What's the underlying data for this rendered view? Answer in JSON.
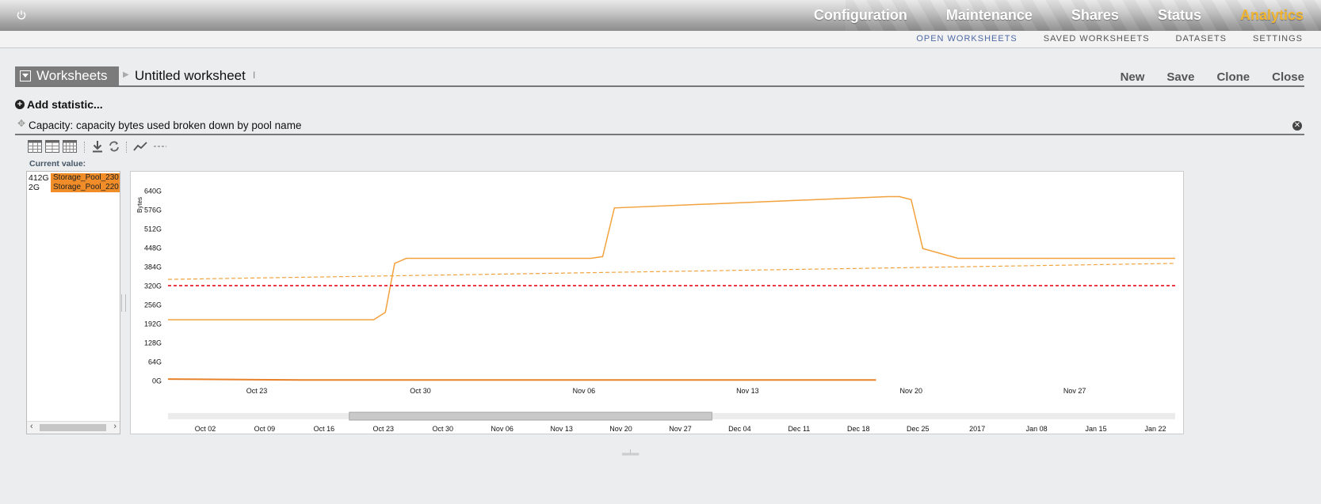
{
  "nav": {
    "items": [
      "Configuration",
      "Maintenance",
      "Shares",
      "Status",
      "Analytics"
    ],
    "active": "Analytics"
  },
  "subnav": {
    "items": [
      "OPEN WORKSHEETS",
      "SAVED WORKSHEETS",
      "DATASETS",
      "SETTINGS"
    ],
    "active": "OPEN WORKSHEETS"
  },
  "worksheet": {
    "tab_label": "Worksheets",
    "title": "Untitled worksheet",
    "actions": [
      "New",
      "Save",
      "Clone",
      "Close"
    ]
  },
  "add_statistic": "Add statistic...",
  "statistic": {
    "title": "Capacity: capacity bytes used broken down by pool name"
  },
  "current_value": {
    "label": "Current value:",
    "rows": [
      {
        "value": "412G",
        "pool": "Storage_Pool_230"
      },
      {
        "value": "2G",
        "pool": "Storage_Pool_220"
      }
    ]
  },
  "colors": {
    "series": "#f2a23c",
    "series_dark": "#e8822a",
    "threshold": "#e8202a",
    "accent": "#f2b632",
    "subnav_active": "#4d68a6"
  },
  "chart_data": {
    "type": "line",
    "ylabel": "Bytes",
    "y_ticks": [
      "0G",
      "64G",
      "128G",
      "192G",
      "256G",
      "320G",
      "384G",
      "448G",
      "512G",
      "576G",
      "640G"
    ],
    "ylim": [
      0,
      640
    ],
    "x_ticks": [
      {
        "label": "Oct 23",
        "day": 0
      },
      {
        "label": "Oct 30",
        "day": 7
      },
      {
        "label": "Nov 06",
        "day": 14
      },
      {
        "label": "Nov 13",
        "day": 21
      },
      {
        "label": "Nov 20",
        "day": 28
      },
      {
        "label": "Nov 27",
        "day": 35
      }
    ],
    "xlim": [
      -3.8,
      39.3
    ],
    "series": [
      {
        "name": "Storage_Pool_230",
        "x": [
          -3.8,
          3.0,
          5.0,
          5.5,
          5.9,
          6.4,
          11.8,
          14.3,
          14.8,
          15.3,
          27.0,
          27.5,
          28.0,
          28.5,
          30.0,
          39.3
        ],
        "values": [
          205,
          205,
          205,
          230,
          395,
          412,
          412,
          412,
          418,
          582,
          620,
          620,
          610,
          445,
          412,
          412
        ]
      },
      {
        "name": "Storage_Pool_220",
        "x": [
          -3.8,
          0,
          2,
          6,
          26.5
        ],
        "values": [
          5,
          3,
          2,
          2,
          2
        ]
      },
      {
        "name": "",
        "style": "dashed",
        "x": [
          -3.8,
          39.3
        ],
        "values": [
          341,
          395
        ]
      },
      {
        "name": "",
        "style": "dashed",
        "x": [
          -3.8,
          39.3
        ],
        "values": [
          320,
          320
        ]
      }
    ],
    "overview_ticks": [
      "Oct 02",
      "Oct 09",
      "Oct 16",
      "Oct 23",
      "Oct 30",
      "Nov 06",
      "Nov 13",
      "Nov 20",
      "Nov 27",
      "Dec 04",
      "Dec 11",
      "Dec 18",
      "Dec 25",
      "2017",
      "Jan 08",
      "Jan 15",
      "Jan 22"
    ],
    "overview_window": [
      0.18,
      0.54
    ]
  }
}
